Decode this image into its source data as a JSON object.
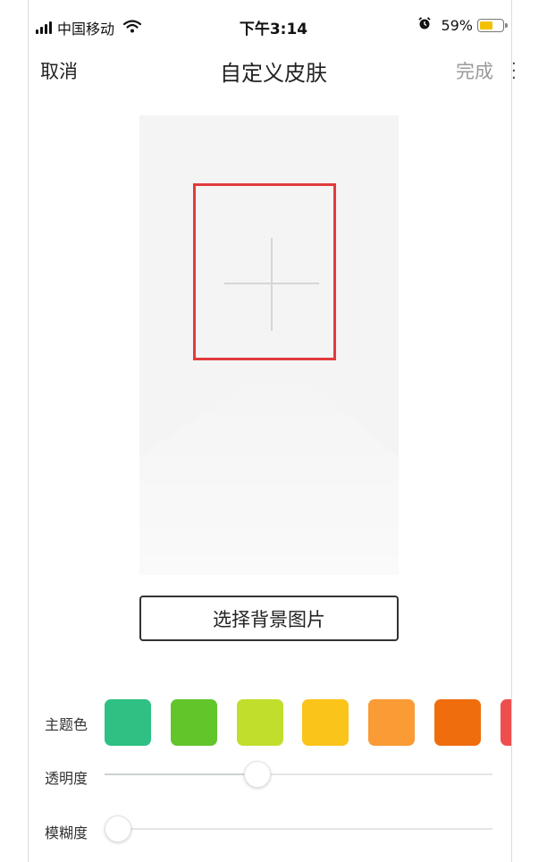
{
  "status_bar": {
    "carrier": "中国移动",
    "time": "下午3:14",
    "battery_percent": "59%",
    "battery_level": 0.59,
    "icons": [
      "signal-icon",
      "wifi-icon",
      "alarm-icon",
      "battery-icon"
    ]
  },
  "nav": {
    "cancel_label": "取消",
    "title": "自定义皮肤",
    "done_label": "完成"
  },
  "preview": {
    "add_icon": "plus-icon",
    "highlight_color": "#e23b3b"
  },
  "select_background_label": "选择背景图片",
  "theme": {
    "label": "主题色",
    "colors": [
      "#2fc083",
      "#62c62b",
      "#c2de2c",
      "#fbc41b",
      "#fa9b35",
      "#f06d0e",
      "#ef4e4e"
    ]
  },
  "opacity": {
    "label": "透明度",
    "value": 0.385
  },
  "blur": {
    "label": "模糊度",
    "value": 0.0
  }
}
